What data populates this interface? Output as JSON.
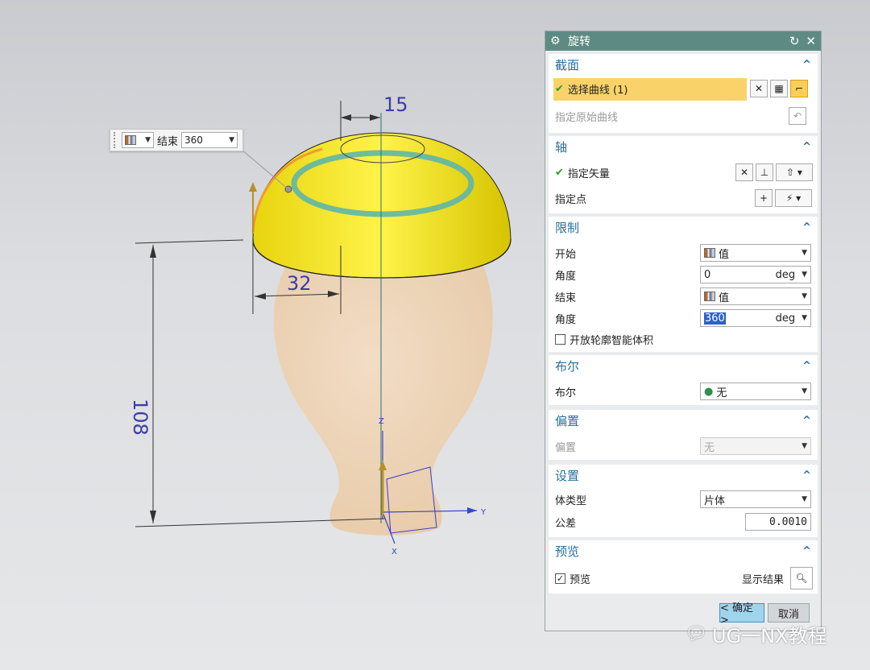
{
  "viewport": {
    "dimensions": {
      "top": "15",
      "left": "32",
      "height": "108"
    },
    "axes": {
      "z": "Z",
      "y": "Y",
      "x": "X"
    }
  },
  "mini_toolbar": {
    "label": "结束",
    "value": "360"
  },
  "dialog": {
    "title": "旋转",
    "section_group": {
      "header": "截面",
      "select_curve": "选择曲线 (1)",
      "specify_original": "指定原始曲线"
    },
    "axis_group": {
      "header": "轴",
      "specify_vector": "指定矢量",
      "specify_point": "指定点"
    },
    "limits_group": {
      "header": "限制",
      "start_label": "开始",
      "start_value": "值",
      "angle_label": "角度",
      "start_angle": "0",
      "unit": "deg",
      "end_label": "结束",
      "end_value": "值",
      "end_angle": "360",
      "open_profile": "开放轮廓智能体积"
    },
    "boolean_group": {
      "header": "布尔",
      "label": "布尔",
      "value": "无"
    },
    "offset_group": {
      "header": "偏置",
      "label": "偏置",
      "value": "无"
    },
    "settings_group": {
      "header": "设置",
      "body_type_label": "体类型",
      "body_type_value": "片体",
      "tolerance_label": "公差",
      "tolerance_value": "0.0010"
    },
    "preview_group": {
      "header": "预览",
      "preview_label": "预览",
      "show_result": "显示结果"
    },
    "ok_button": "< 确定 >",
    "cancel_button": "取消"
  },
  "watermark": "UG一NX教程",
  "colors": {
    "title_bar": "#5d8b84",
    "section_header": "#2b6f9c",
    "highlight": "#f9d36a",
    "dome": "#f1e61c",
    "vase": "#f2d6b4"
  }
}
